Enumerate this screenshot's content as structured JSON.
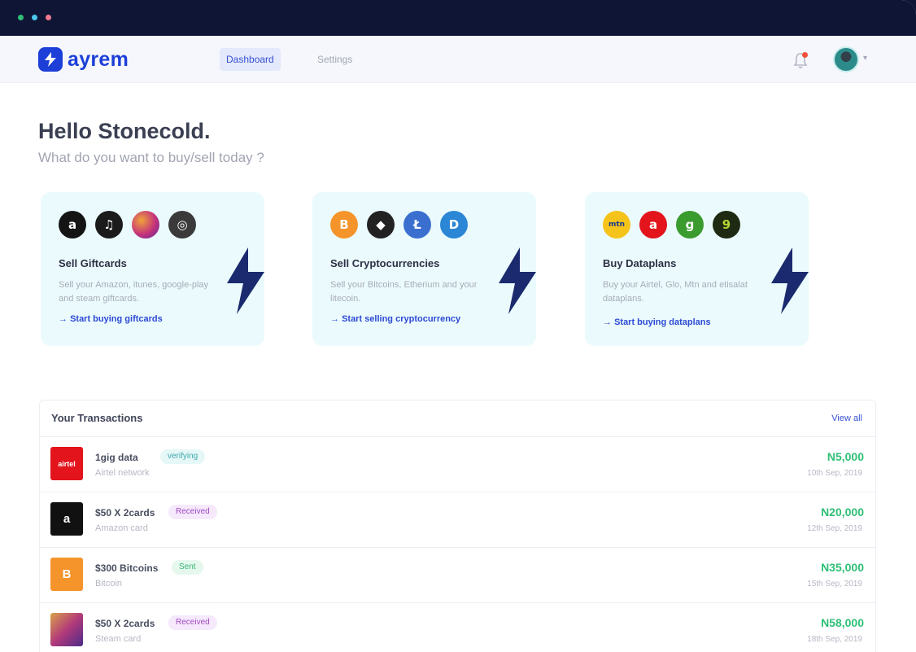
{
  "window": {
    "dot_colors": [
      "#2fbf76",
      "#4cc9ee",
      "#f07a8f"
    ]
  },
  "brand": {
    "name": "ayrem",
    "color": "#1d3fd8"
  },
  "nav": {
    "tabs": [
      {
        "label": "Dashboard",
        "active": true
      },
      {
        "label": "Settings",
        "active": false
      }
    ]
  },
  "header": {
    "notification_icon": "bell-icon",
    "has_notification": true,
    "avatar_icon": "user-avatar"
  },
  "greeting": {
    "title": "Hello Stonecold.",
    "subtitle": "What do you want to buy/sell  today ?"
  },
  "cards": [
    {
      "title": "Sell Giftcards",
      "description": "Sell your Amazon, itunes, google-play and steam giftcards.",
      "link": "Start buying giftcards",
      "icons": [
        {
          "name": "amazon-icon",
          "glyph": "a",
          "color": "#141414"
        },
        {
          "name": "itunes-icon",
          "glyph": "♫",
          "color": "#1b1b1b"
        },
        {
          "name": "google-play-icon",
          "glyph": "",
          "color": "#c4327c"
        },
        {
          "name": "steam-icon",
          "glyph": "◎",
          "color": "#3a3a3a"
        }
      ]
    },
    {
      "title": "Sell Cryptocurrencies",
      "description": "Sell your Bitcoins, Etherium and your litecoin.",
      "link": "Start selling cryptocurrency",
      "icons": [
        {
          "name": "bitcoin-icon",
          "glyph": "B",
          "color": "#f4942a"
        },
        {
          "name": "ethereum-icon",
          "glyph": "◆",
          "color": "#222222"
        },
        {
          "name": "litecoin-icon",
          "glyph": "Ł",
          "color": "#3a6fd0"
        },
        {
          "name": "dash-icon",
          "glyph": "D",
          "color": "#2b86d6"
        }
      ]
    },
    {
      "title": "Buy Dataplans",
      "description": "Buy your Airtel, Glo, Mtn and etisalat dataplans.",
      "link": "Start buying dataplans",
      "icons": [
        {
          "name": "mtn-icon",
          "glyph": "mtn",
          "color": "#f6c31b"
        },
        {
          "name": "airtel-icon",
          "glyph": "a",
          "color": "#e3141c"
        },
        {
          "name": "glo-icon",
          "glyph": "g",
          "color": "#3a9b2e"
        },
        {
          "name": "etisalat-icon",
          "glyph": "9",
          "color": "#1e2a12"
        }
      ]
    }
  ],
  "transactions": {
    "title": "Your Transactions",
    "view_all": "View all",
    "rows": [
      {
        "name": "1gig data",
        "status": "verifying",
        "sub": "Airtel network",
        "amount": "N5,000",
        "date": "10th Sep, 2019",
        "thumb_color": "#e3141c",
        "thumb_glyph": "airtel",
        "thumb_icon": "airtel-thumb"
      },
      {
        "name": "$50 X 2cards",
        "status": "Received",
        "sub": "Amazon card",
        "amount": "N20,000",
        "date": "12th Sep, 2019",
        "thumb_color": "#111111",
        "thumb_glyph": "a",
        "thumb_icon": "amazon-thumb"
      },
      {
        "name": "$300 Bitcoins",
        "status": "Sent",
        "sub": "Bitcoin",
        "amount": "N35,000",
        "date": "15th Sep, 2019",
        "thumb_color": "#f4942a",
        "thumb_glyph": "B",
        "thumb_icon": "bitcoin-thumb"
      },
      {
        "name": "$50 X 2cards",
        "status": "Received",
        "sub": "Steam card",
        "amount": "N58,000",
        "date": "18th Sep, 2019",
        "thumb_color": "#b23a7a",
        "thumb_glyph": "",
        "thumb_icon": "steam-card-thumb"
      }
    ]
  }
}
